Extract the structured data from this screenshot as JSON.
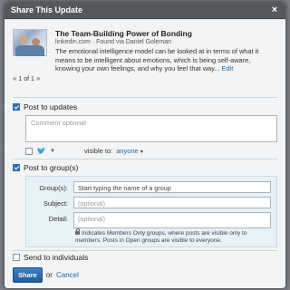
{
  "dialog": {
    "title": "Share This Update",
    "close_glyph": "×"
  },
  "preview": {
    "title": "The Team-Building Power of Bonding",
    "source": "linkedin.com · Found via Daniel Goleman",
    "description": "The emotional intelligence model can be looked at in terms of what it means to be intelligent about emotions, which is being self-aware, knowing your own feelings, and why you feel that way...",
    "edit_label": "Edit",
    "pager": "1 of 1"
  },
  "post_updates": {
    "label": "Post to updates",
    "checked": true,
    "comment_placeholder": "Comment optional",
    "twitter_checked": false,
    "visible_to_label": "visible to:",
    "visible_to_value": "anyone"
  },
  "post_groups": {
    "label": "Post to group(s)",
    "checked": true,
    "groups_label": "Group(s):",
    "groups_placeholder": "Start typing the name of a group",
    "subject_label": "Subject:",
    "subject_placeholder": "(optional)",
    "detail_label": "Detail:",
    "detail_placeholder": "(optional)",
    "hint": "Indicates Members Only groups, where posts are visible only to members. Posts in Open groups are visible to everyone."
  },
  "send_individuals": {
    "label": "Send to individuals",
    "checked": false
  },
  "actions": {
    "share_label": "Share",
    "or_text": "or",
    "cancel_label": "Cancel"
  },
  "colors": {
    "header_bg": "#55595e",
    "accent": "#2f6fb3",
    "link": "#1a69a8",
    "group_panel_bg": "#e6f1f8"
  }
}
